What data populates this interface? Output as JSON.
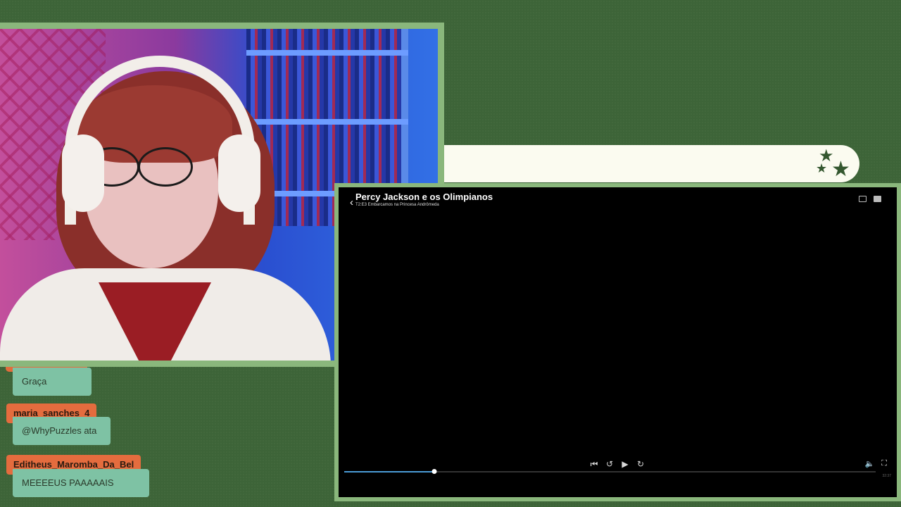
{
  "player": {
    "show_title": "Percy Jackson e os Olimpianos",
    "episode": "T2:E3 Embarcamos na Princesa Andrômeda",
    "progress": 0.17,
    "time_remaining": "32:37",
    "icons": {
      "back": "chevron-left-icon",
      "cast": "cast-icon",
      "subtitles": "subtitles-icon",
      "skip_back": "skip-previous-icon",
      "rewind": "rewind-10-icon",
      "play": "play-icon",
      "forward": "forward-10-icon",
      "volume": "volume-icon",
      "fullscreen": "fullscreen-icon"
    }
  },
  "chat": {
    "messages": [
      {
        "user": "",
        "text": "Graça"
      },
      {
        "user": "maria_sanches_4",
        "text": "@WhyPuzzles ata"
      },
      {
        "user": "Editheus_Maromba_Da_Bel",
        "text": "MEEEEUS PAAAAAIS"
      }
    ]
  },
  "colors": {
    "background": "#3d6438",
    "frame": "#8ab77c",
    "username_tag": "#e46c3e",
    "message_bubble": "#7ec2a4",
    "title_bar": "#fbfbf0",
    "progress": "#4b9bd6"
  }
}
